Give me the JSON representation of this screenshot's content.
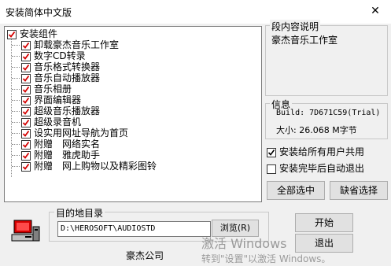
{
  "window": {
    "title": "安装简体中文版",
    "close_glyph": "✕"
  },
  "components": {
    "root_label": "安装组件",
    "items": [
      "卸载豪杰音乐工作室",
      "数字CD转录",
      "音乐格式转换器",
      "音乐自动播放器",
      "音乐相册",
      "界面编辑器",
      "超级音乐播放器",
      "超级录音机",
      "设实用网址导航为首页",
      "附赠　网络实名",
      "附赠　雅虎助手",
      "附赠　网上购物以及精彩图铃"
    ]
  },
  "description": {
    "title": "段内容说明",
    "text": "豪杰音乐工作室"
  },
  "info": {
    "title": "信息",
    "build": "Build: 7D671C59(Trial)",
    "size": "大小: 26.068 M字节"
  },
  "options": {
    "all_users": {
      "label": "安装给所有用户共用",
      "checked": true
    },
    "auto_exit": {
      "label": "安装完毕后自动退出",
      "checked": false
    }
  },
  "buttons": {
    "select_all": "全部选中",
    "default_select": "缺省选择",
    "install": "开始",
    "exit": "退出",
    "browse": "浏览(R)"
  },
  "destination": {
    "title": "目的地目录",
    "path": "D:\\HEROSOFT\\AUDIOSTD"
  },
  "company": "豪杰公司",
  "watermark": {
    "line1": "激活 Windows",
    "line2": "转到\"设置\"以激活 Windows。"
  },
  "icons": {
    "installer": "installer-computer-icon",
    "check": "checkmark-icon"
  },
  "colors": {
    "check_red": "#d40000",
    "window_bg": "#f0f0f0"
  }
}
